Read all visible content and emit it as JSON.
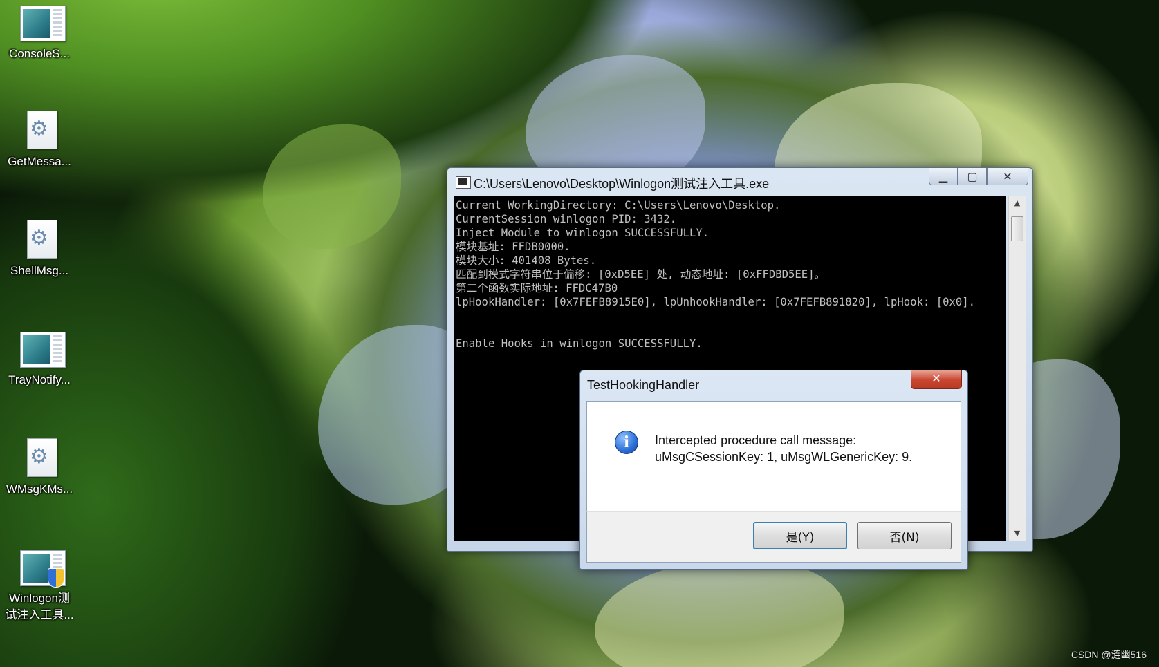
{
  "desktop": {
    "icons": [
      {
        "label": "ConsoleS...",
        "icon": "app-window-icon"
      },
      {
        "label": "GetMessa...",
        "icon": "gear-document-icon"
      },
      {
        "label": "ShellMsg...",
        "icon": "gear-document-icon"
      },
      {
        "label": "TrayNotify...",
        "icon": "app-window-icon"
      },
      {
        "label": "WMsgKMs...",
        "icon": "gear-document-icon"
      },
      {
        "label_line1": "Winlogon测",
        "label_line2": "试注入工具...",
        "icon": "app-window-shield-icon"
      }
    ],
    "watermark": "CSDN @涟幽516"
  },
  "console": {
    "title": "C:\\Users\\Lenovo\\Desktop\\Winlogon测试注入工具.exe",
    "buttons": {
      "minimize": "▁",
      "maximize": "▢",
      "close": "✕"
    },
    "lines": [
      "Current WorkingDirectory: C:\\Users\\Lenovo\\Desktop.",
      "CurrentSession winlogon PID: 3432.",
      "Inject Module to winlogon SUCCESSFULLY.",
      "模块基址: FFDB0000.",
      "模块大小: 401408 Bytes.",
      "匹配到模式字符串位于偏移: [0xD5EE] 处, 动态地址: [0xFFDBD5EE]。",
      "第二个函数实际地址: FFDC47B0",
      "lpHookHandler: [0x7FEFB8915E0], lpUnhookHandler: [0x7FEFB891820], lpHook: [0x0].",
      "",
      "",
      "Enable Hooks in winlogon SUCCESSFULLY."
    ],
    "scroll": {
      "up": "▲",
      "down": "▼"
    }
  },
  "messagebox": {
    "title": "TestHookingHandler",
    "close": "✕",
    "icon": "information-icon",
    "icon_glyph": "i",
    "line1": "Intercepted procedure call message:",
    "line2": "uMsgCSessionKey: 1, uMsgWLGenericKey: 9.",
    "yes_label": "是(Y)",
    "no_label": "否(N)"
  }
}
